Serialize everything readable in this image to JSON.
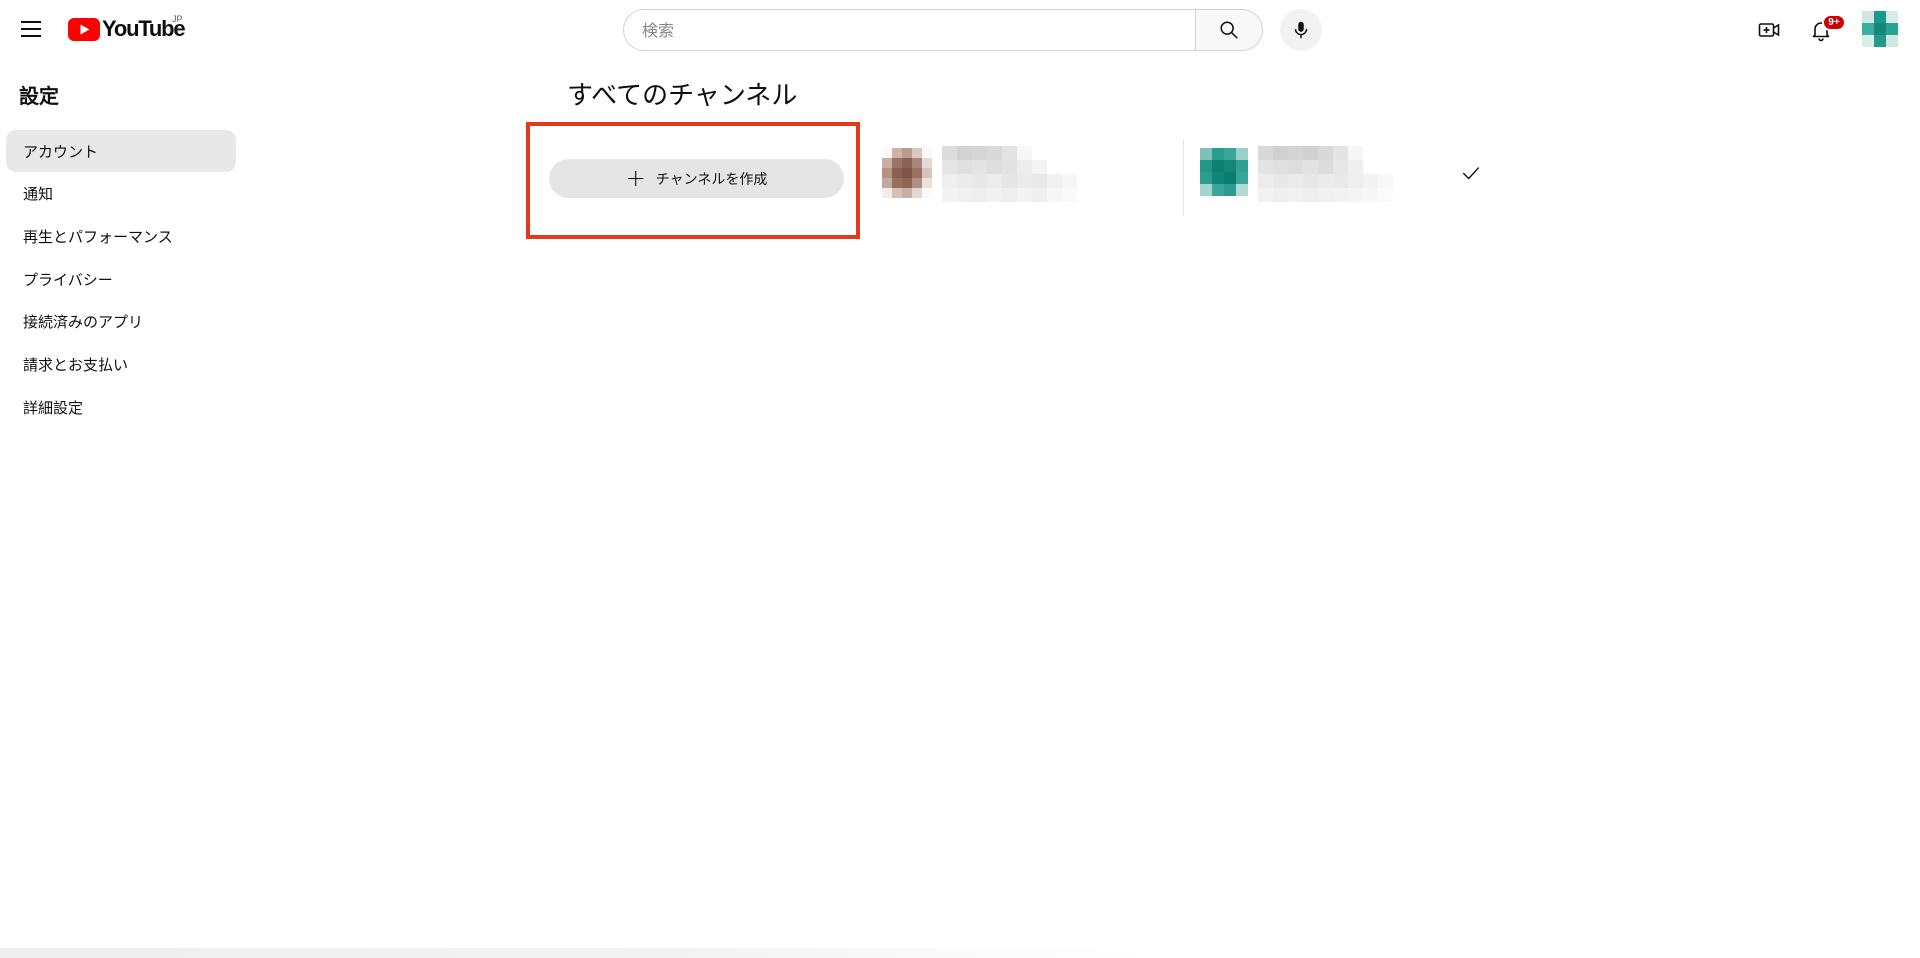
{
  "header": {
    "logo_text": "YouTube",
    "logo_region": "JP",
    "search_placeholder": "検索",
    "notification_badge": "9+",
    "brand_color": "#ff0000"
  },
  "sidebar": {
    "title": "設定",
    "items": [
      {
        "label": "アカウント",
        "active": true
      },
      {
        "label": "通知",
        "active": false
      },
      {
        "label": "再生とパフォーマンス",
        "active": false
      },
      {
        "label": "プライバシー",
        "active": false
      },
      {
        "label": "接続済みのアプリ",
        "active": false
      },
      {
        "label": "請求とお支払い",
        "active": false
      },
      {
        "label": "詳細設定",
        "active": false
      }
    ]
  },
  "main": {
    "heading": "すべてのチャンネル",
    "create_channel_label": "チャンネルを作成",
    "highlight_color": "#e2381c",
    "channels": [
      {
        "name_blurred": true,
        "selected": false
      },
      {
        "name_blurred": true,
        "selected": true
      }
    ]
  }
}
